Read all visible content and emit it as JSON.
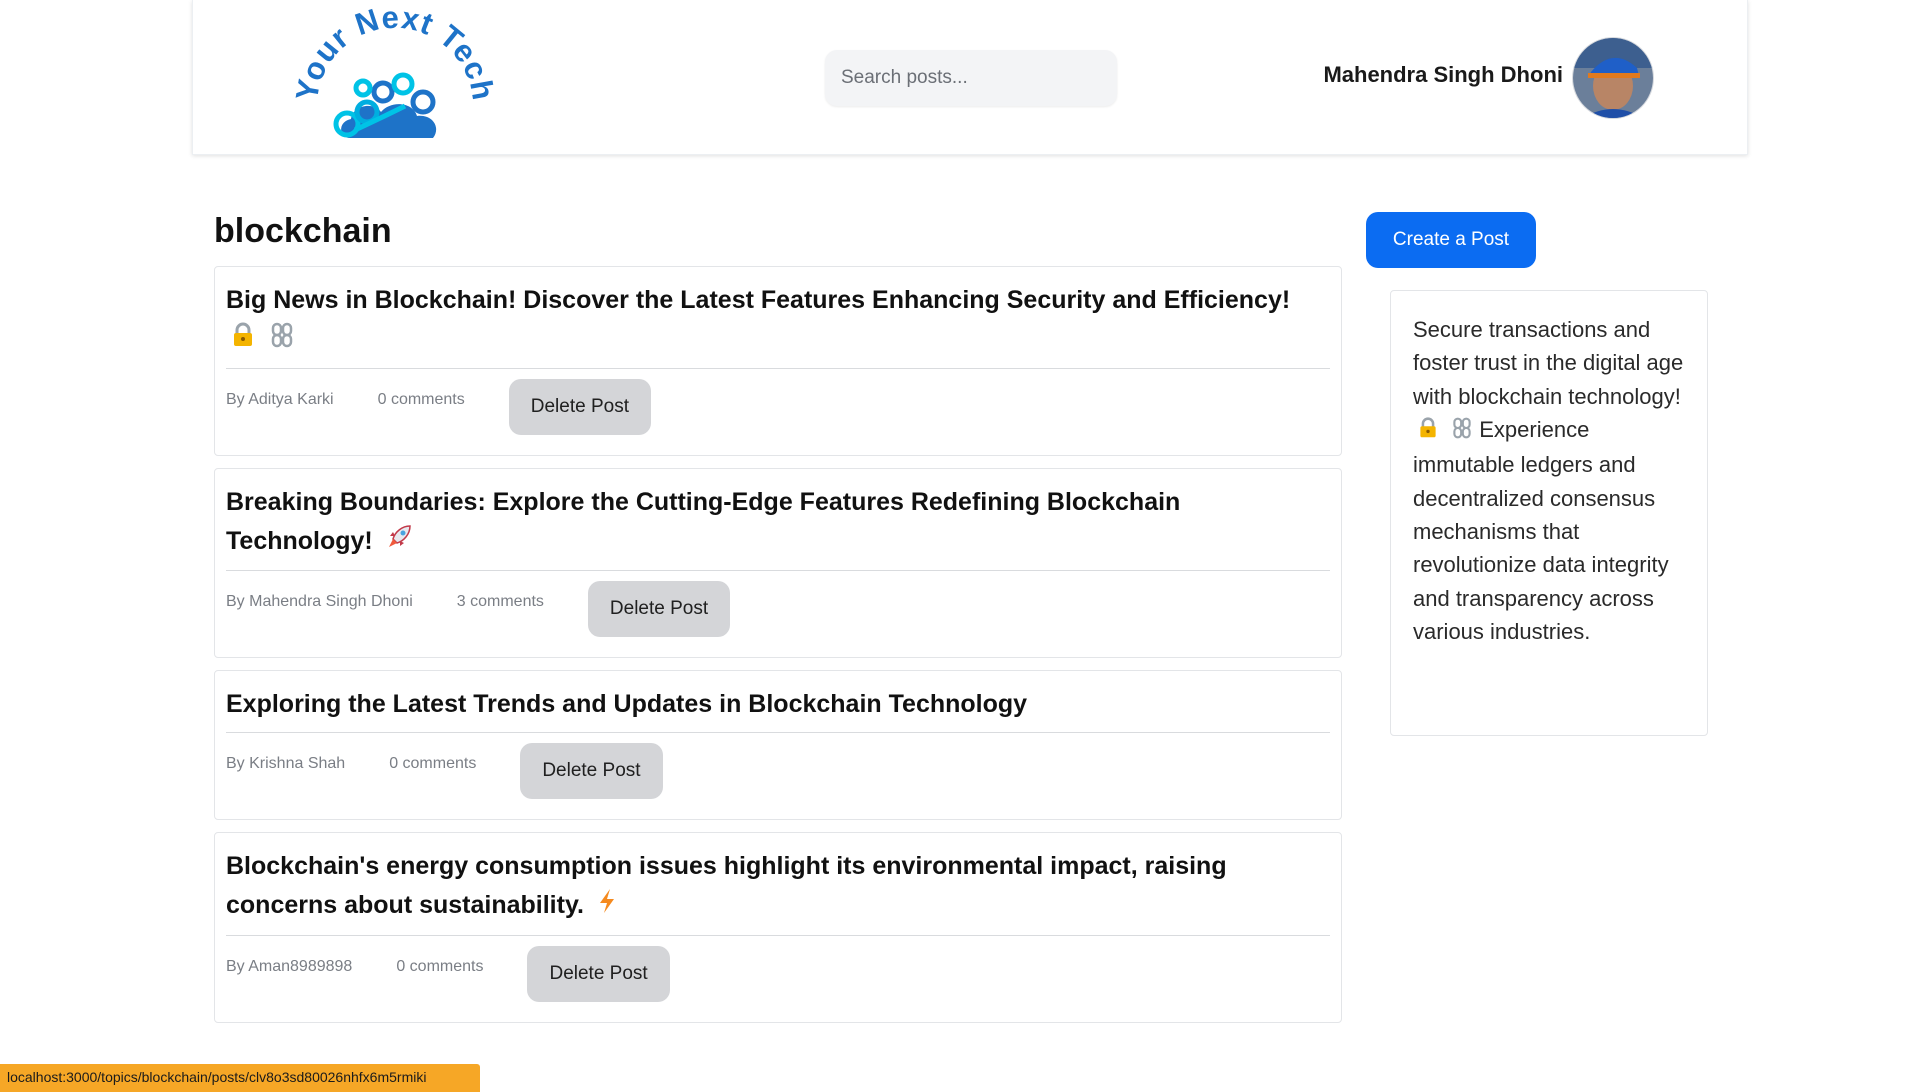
{
  "header": {
    "logo_text": "Your Next Tech",
    "search_placeholder": "Search posts...",
    "user_name": "Mahendra Singh Dhoni"
  },
  "topic": {
    "title": "blockchain"
  },
  "posts": [
    {
      "title": "Big News in Blockchain! Discover the Latest Features Enhancing Security and Efficiency!",
      "emojis": [
        "lock-icon",
        "chain-icon"
      ],
      "author": "By Aditya Karki",
      "comments": "0 comments",
      "delete_label": "Delete Post"
    },
    {
      "title": "Breaking Boundaries: Explore the Cutting-Edge Features Redefining Blockchain Technology!",
      "emojis": [
        "rocket-icon"
      ],
      "author": "By Mahendra Singh Dhoni",
      "comments": "3 comments",
      "delete_label": "Delete Post"
    },
    {
      "title": "Exploring the Latest Trends and Updates in Blockchain Technology",
      "emojis": [],
      "author": "By Krishna Shah",
      "comments": "0 comments",
      "delete_label": "Delete Post"
    },
    {
      "title": "Blockchain's energy consumption issues highlight its environmental impact, raising concerns about sustainability.",
      "emojis": [
        "lightning-icon"
      ],
      "author": "By Aman8989898",
      "comments": "0 comments",
      "delete_label": "Delete Post"
    }
  ],
  "sidebar": {
    "create_label": "Create a Post",
    "description_before": "Secure transactions and foster trust in the digital age with blockchain technology!",
    "description_after": "Experience immutable ledgers and decentralized consensus mechanisms that revolutionize data integrity and transparency across various industries."
  },
  "status_bar": {
    "url": "localhost:3000/topics/blockchain/posts/clv8o3sd80026nhfx6m5rmiki"
  },
  "colors": {
    "primary": "#0b6cf2",
    "delete_bg": "#d4d5d8",
    "status_bar": "#f6a726",
    "logo_blue": "#1e73c8",
    "logo_cyan": "#00c3e6"
  }
}
